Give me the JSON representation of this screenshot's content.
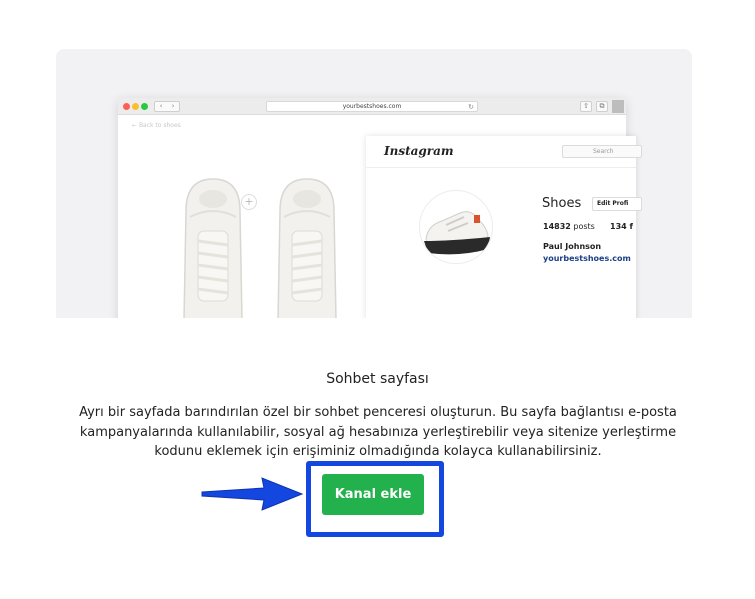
{
  "browser": {
    "url": "yourbestshoes.com",
    "back_link": "Back to shoes"
  },
  "instagram": {
    "logo": "Instagram",
    "search_placeholder": "Search",
    "profile_name": "Shoes",
    "edit_profile_label": "Edit Profi",
    "posts_count": "14832",
    "posts_label": "posts",
    "followers_partial": "134 f",
    "user_name": "Paul Johnson",
    "website": "yourbestshoes.com"
  },
  "card": {
    "title": "Sohbet sayfası",
    "description": "Ayrı bir sayfada barındırılan özel bir sohbet penceresi oluşturun. Bu sayfa bağlantısı e-posta kampanyalarında kullanılabilir, sosyal ağ hesabınıza yerleştirebilir veya sitenize yerleştirme kodunu eklemek için erişiminiz olmadığında kolayca kullanabilirsiniz.",
    "button_label": "Kanal ekle"
  },
  "colors": {
    "button_green": "#22b14c",
    "highlight_blue": "#1446e0"
  }
}
